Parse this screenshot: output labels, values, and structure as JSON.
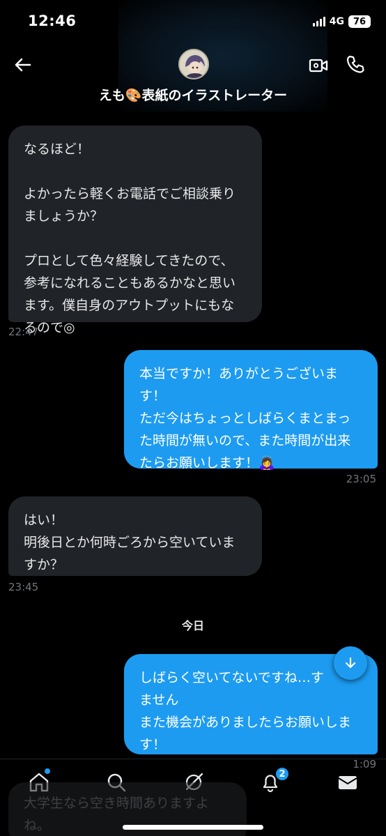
{
  "status": {
    "time": "12:46",
    "network": "4G",
    "battery": "76"
  },
  "header": {
    "title": "えも🎨表紙のイラストレーター"
  },
  "messages": [
    {
      "type": "incoming",
      "text": "なるほど！\n\nよかったら軽くお電話でご相談乗りましょうか？\n\nプロとして色々経験してきたので、参考になれることもあるかなと思います。僕自身のアウトプットにもなるので◎",
      "time": "22:47"
    },
    {
      "type": "outgoing",
      "text": "本当ですか！ありがとうございます！\nただ今はちょっとしばらくまとまった時間が無いので、また時間が出来たらお願いします！🙇‍♀️",
      "time": "23:05"
    },
    {
      "type": "incoming",
      "text": "はい！\n明後日とか何時ごろから空いていますか？",
      "time": "23:45"
    },
    {
      "type": "outgoing",
      "text": "しばらく空いてないですね…す\nません\nまた機会がありましたらお願いします！",
      "time": "1:09"
    }
  ],
  "date_separator": "今日",
  "tabs": {
    "notifications_badge": "2"
  },
  "draft_preview": "大学生なら空き時間ありますよね。\n明日…"
}
